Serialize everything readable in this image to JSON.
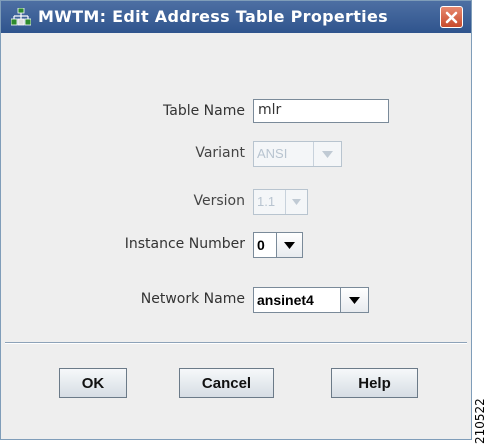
{
  "window": {
    "title": "MWTM: Edit Address Table Properties"
  },
  "icons": {
    "app": "network-tree-icon",
    "close": "close-icon",
    "dropdown": "chevron-down-icon"
  },
  "form": {
    "table_name": {
      "label": "Table Name",
      "value": "mlr"
    },
    "variant": {
      "label": "Variant",
      "value": "ANSI",
      "disabled": true
    },
    "version": {
      "label": "Version",
      "value": "1.1",
      "disabled": true
    },
    "instance_number": {
      "label": "Instance Number",
      "value": "0"
    },
    "network_name": {
      "label": "Network Name",
      "value": "ansinet4"
    }
  },
  "buttons": {
    "ok": "OK",
    "cancel": "Cancel",
    "help": "Help"
  },
  "figure_id": "210522",
  "colors": {
    "titlebar": "#3a5f96",
    "close_button": "#d4553a",
    "dialog_bg": "#eeeeee"
  }
}
